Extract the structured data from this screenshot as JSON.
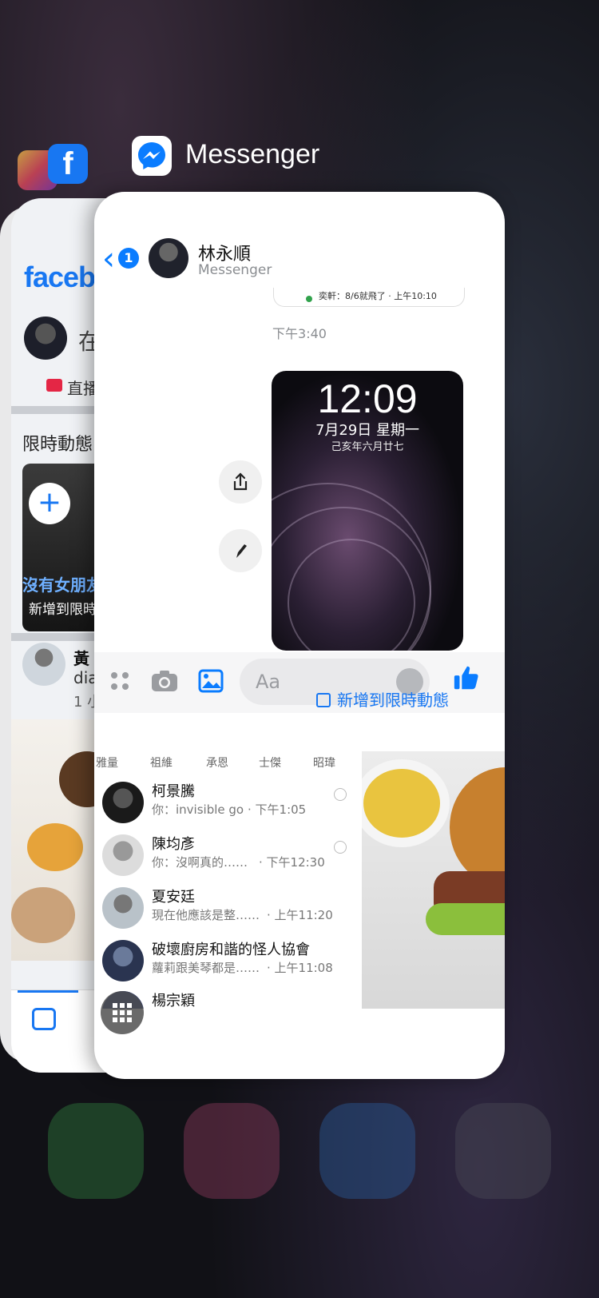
{
  "switcher": {
    "active_app_title": "Messenger"
  },
  "facebook_card": {
    "logo_text": "faceb",
    "post_placeholder": "在",
    "live_label": "直播",
    "stories_title": "限時動態",
    "story_overlay_text": "沒有女朋友",
    "story_add_label": "新增到限時",
    "post_author": "黃",
    "post_subtitle": "dia",
    "post_time": "1 小"
  },
  "messenger_card": {
    "chat": {
      "back_badge": "1",
      "contact_name": "林永順",
      "contact_sub": "Messenger",
      "previous_message": "奕軒：8/6就飛了 · 上午10:10",
      "timestamp": "下午3:40",
      "image_lock_time": "12:09",
      "image_lock_date": "7月29日 星期一",
      "image_lock_lunar": "己亥年六月廿七",
      "composer_placeholder": "Aa",
      "add_to_story_label": "新增到限時動態"
    },
    "inbox": {
      "active_names": [
        "雅量",
        "祖維",
        "承恩",
        "士傑",
        "昭瑋"
      ],
      "conversations": [
        {
          "name": "柯景騰",
          "preview": "你：invisible go",
          "time": "· 下午1:05"
        },
        {
          "name": "陳均彥",
          "preview": "你：沒啊真的……",
          "time": "· 下午12:30"
        },
        {
          "name": "夏安廷",
          "preview": "現在他應該是整……",
          "time": "· 上午11:20"
        },
        {
          "name": "破壞廚房和諧的怪人協會",
          "preview": "蘿莉跟美琴都是……",
          "time": "· 上午11:08"
        },
        {
          "name": "楊宗穎",
          "preview": "",
          "time": ""
        }
      ]
    }
  },
  "colors": {
    "messenger_blue": "#0a7cff",
    "facebook_blue": "#1877f2"
  }
}
